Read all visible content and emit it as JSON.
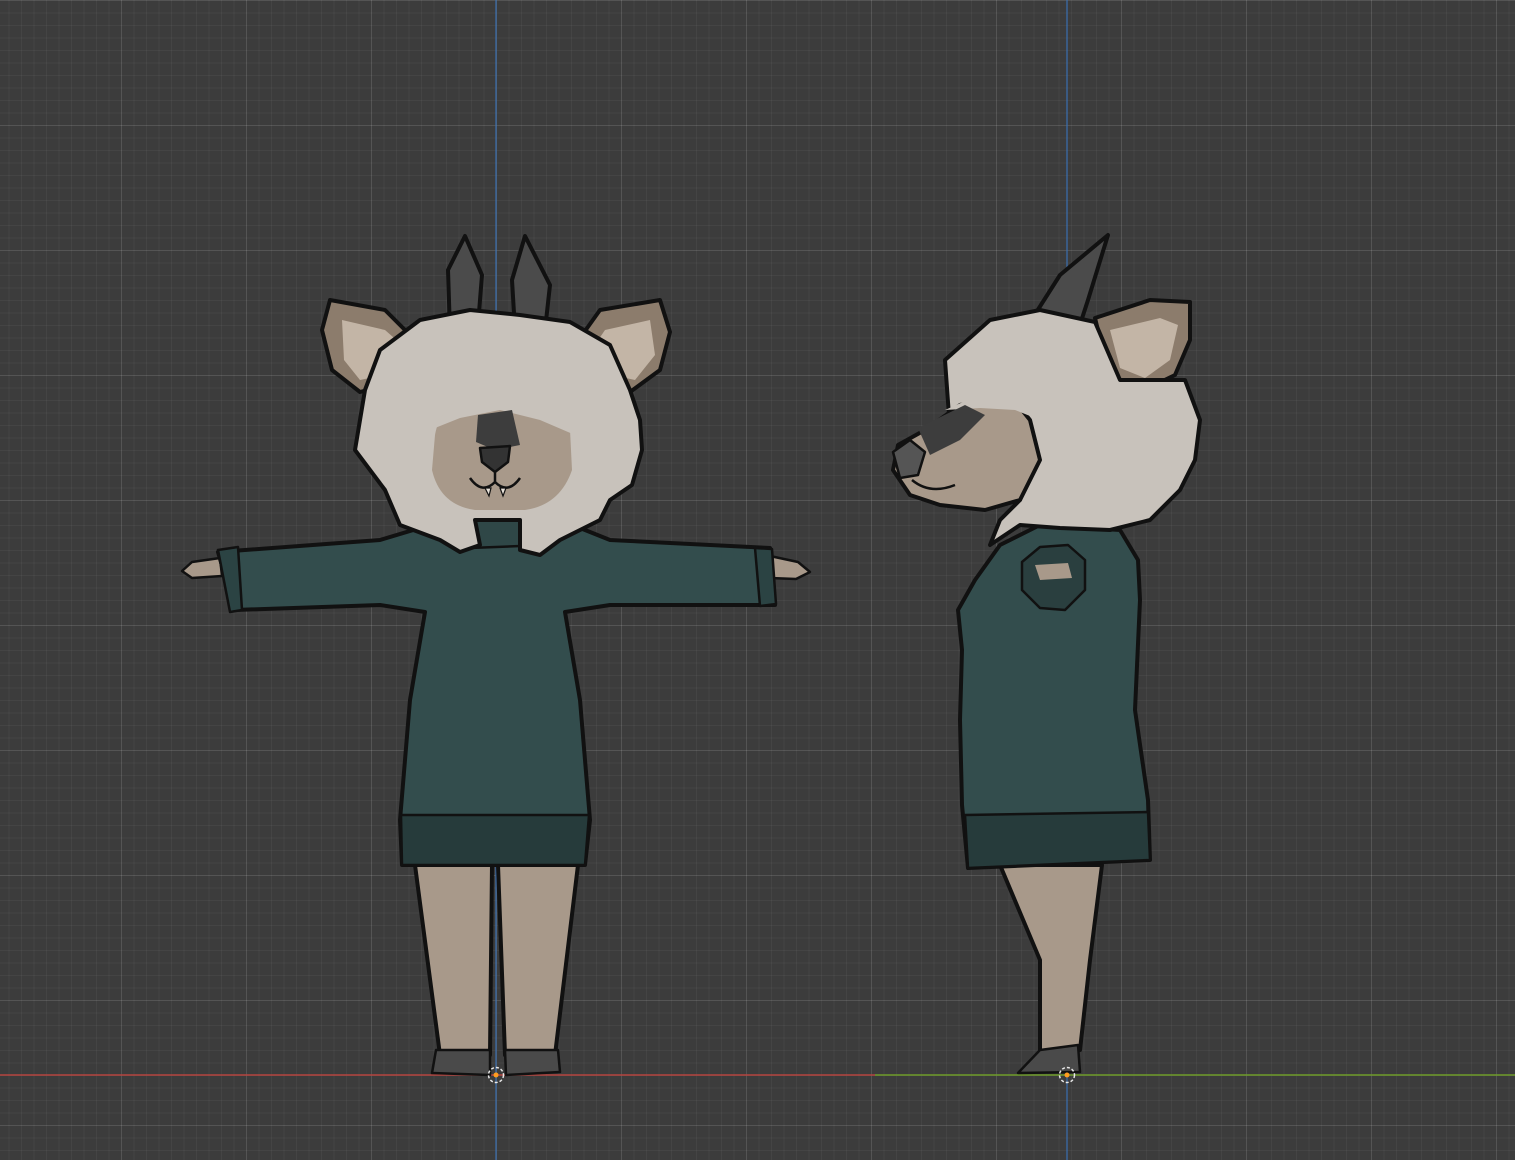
{
  "viewport": {
    "label": "3D viewport",
    "background": "#3c3c3c",
    "grid_color": "#4a4a4a"
  },
  "axes": {
    "x_axis_color": "#b5443f",
    "y_axis_color": "#6e9b2a",
    "z_axis_color": "#3a6fb0"
  },
  "character": {
    "views": [
      "front",
      "side"
    ],
    "colors": {
      "fur": "#a8998a",
      "ear_inner": "#c3b5a6",
      "hair": "#c8c2bb",
      "horn": "#4b4b4b",
      "sweater": "#334d4d",
      "sweater_cuff": "#263b3b",
      "muzzle_dark": "#3d3d3d",
      "shoe": "#4a4a4a",
      "outline": "#111111"
    }
  },
  "origin_markers": [
    {
      "name": "front-origin"
    },
    {
      "name": "side-origin"
    }
  ]
}
